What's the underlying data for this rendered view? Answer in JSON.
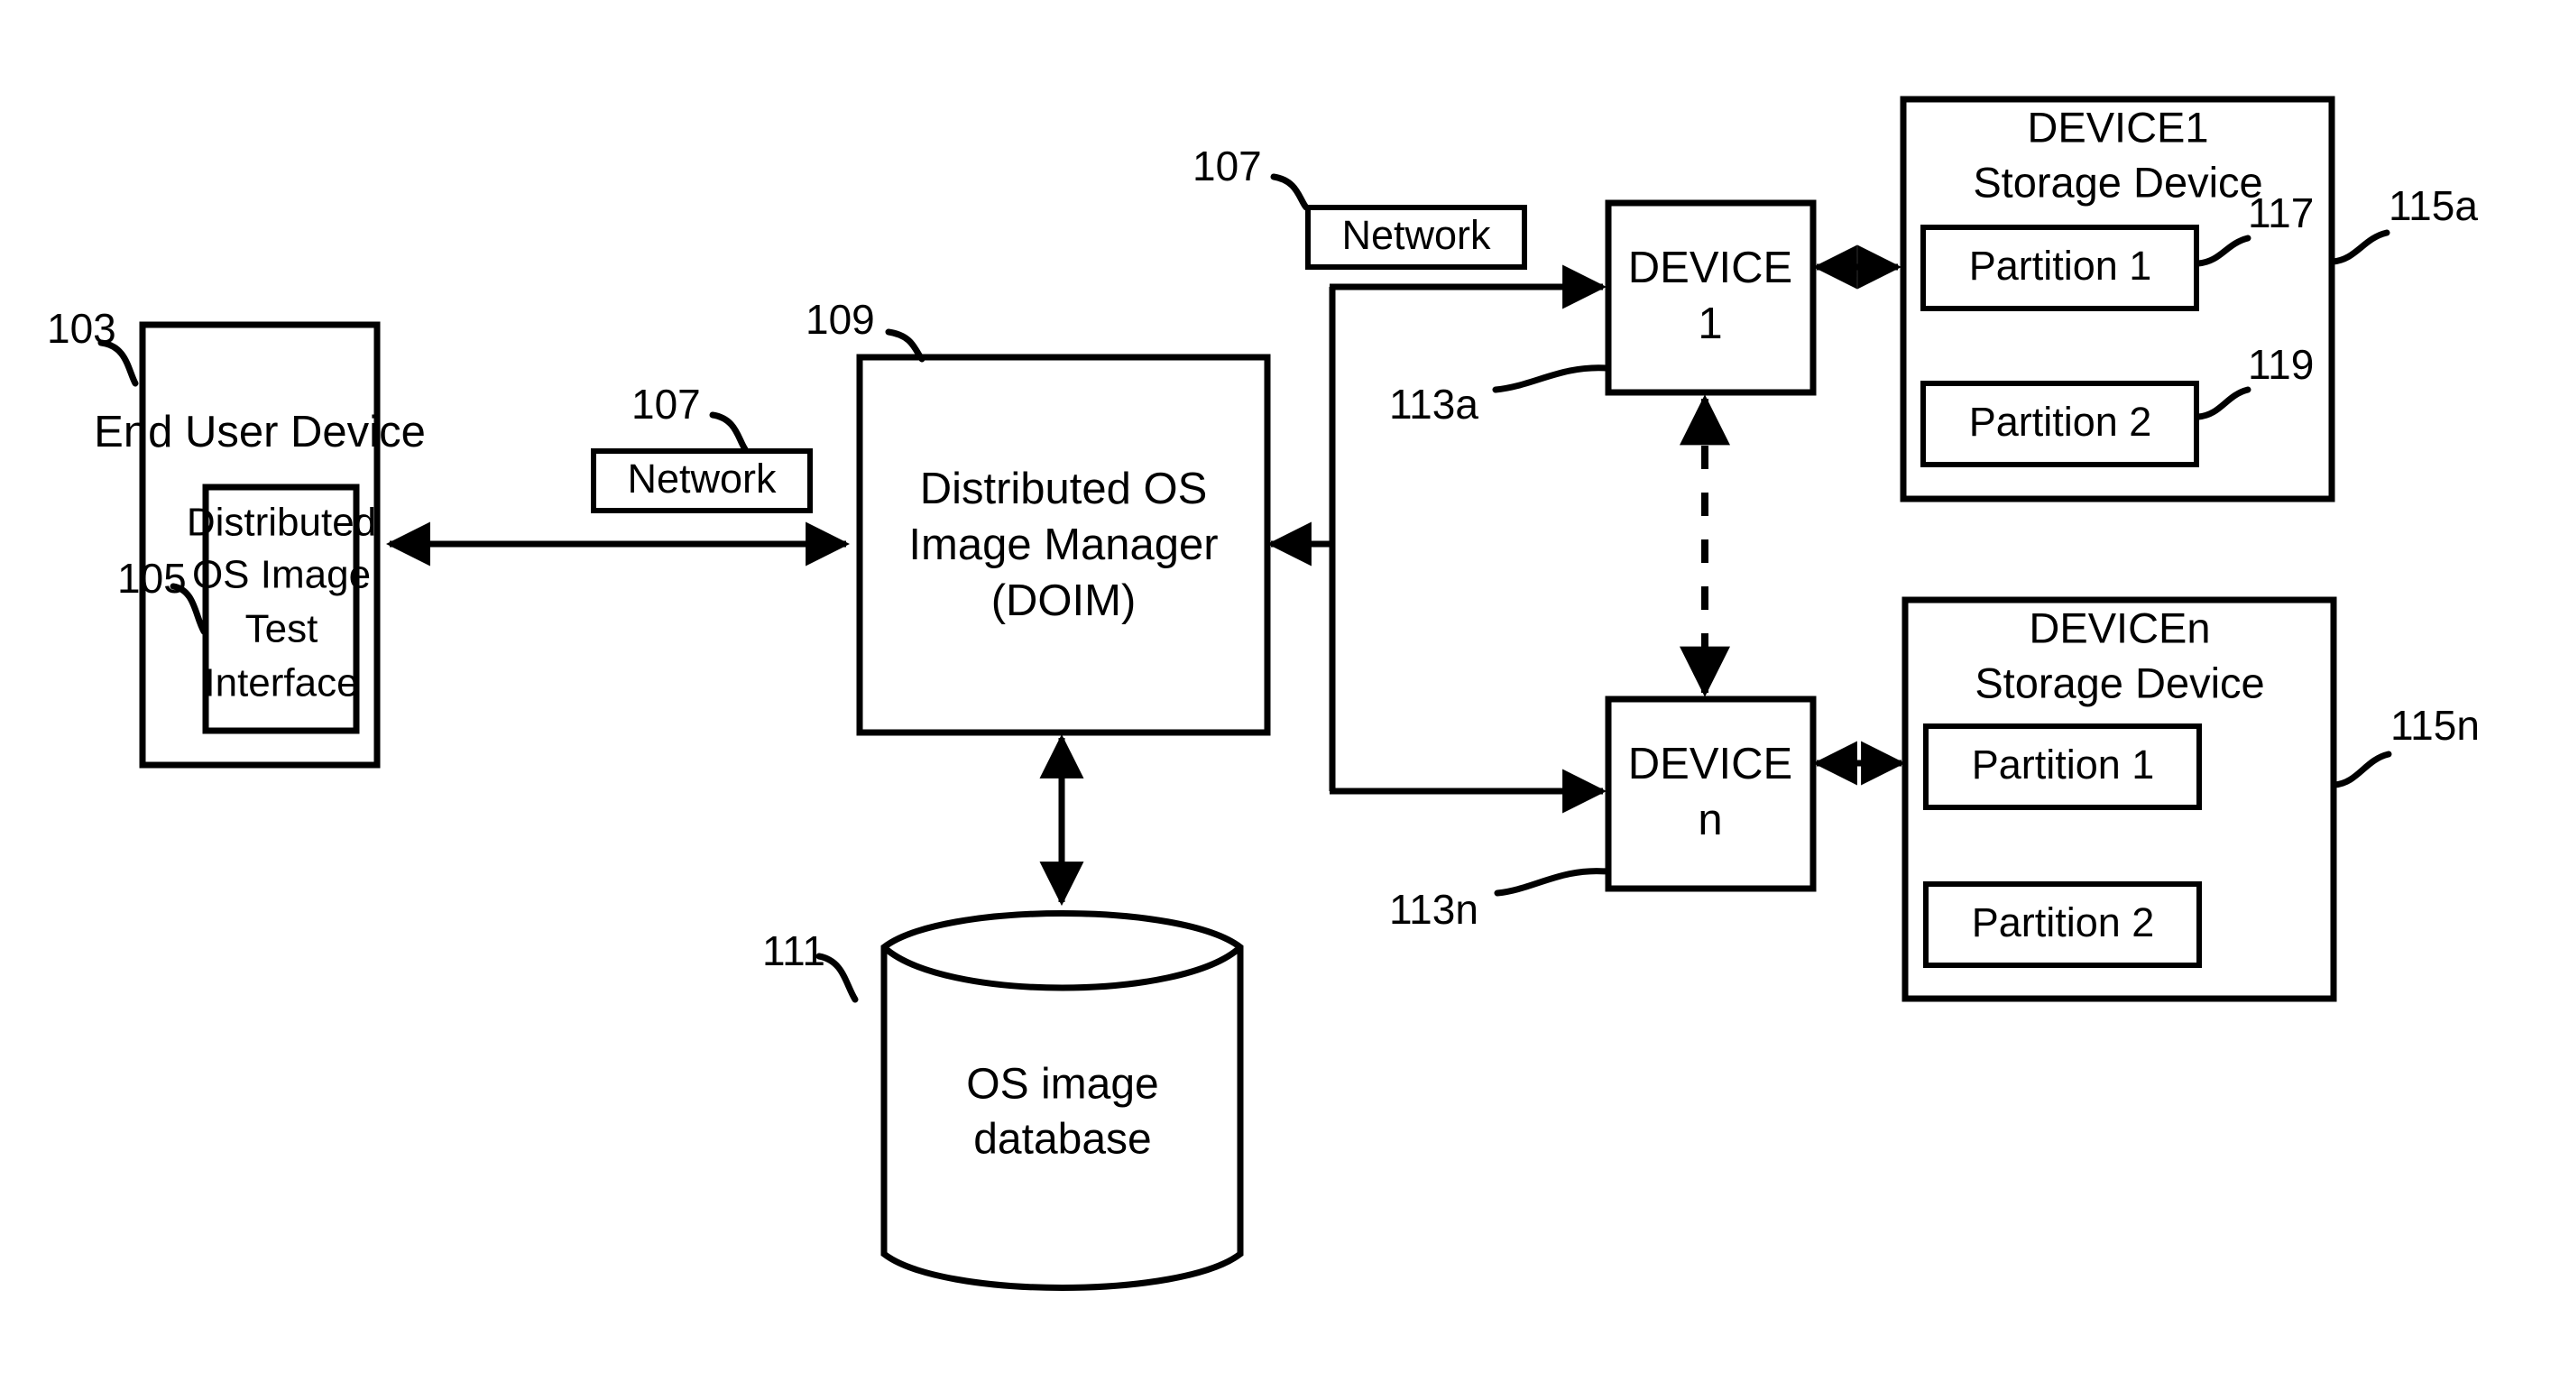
{
  "figure": {
    "title": "Distributed OS Image Manager system block diagram",
    "line_color": "#000000",
    "background_color": "#ffffff"
  },
  "nodes": {
    "end_user_device": {
      "label": "End User Device",
      "ref": "103"
    },
    "test_interface": {
      "line1": "Distributed",
      "line2": "OS Image",
      "line3": "Test",
      "line4": "Interface",
      "ref": "105"
    },
    "network_left": {
      "label": "Network",
      "ref": "107"
    },
    "network_right": {
      "label": "Network",
      "ref": "107"
    },
    "doim": {
      "line1": "Distributed OS",
      "line2": "Image Manager",
      "line3": "(DOIM)",
      "ref": "109"
    },
    "os_image_database": {
      "line1": "OS image",
      "line2": "database",
      "ref": "111"
    },
    "device1": {
      "line1": "DEVICE",
      "line2": "1",
      "ref": "113a"
    },
    "device_n": {
      "line1": "DEVICE",
      "line2": "n",
      "ref": "113n"
    },
    "device1_storage": {
      "line1": "DEVICE1",
      "line2": "Storage Device",
      "ref": "115a",
      "partitions": [
        {
          "label": "Partition 1",
          "ref": "117"
        },
        {
          "label": "Partition 2",
          "ref": "119"
        }
      ]
    },
    "device_n_storage": {
      "line1": "DEVICEn",
      "line2": "Storage Device",
      "ref": "115n",
      "partitions": [
        {
          "label": "Partition 1",
          "ref": ""
        },
        {
          "label": "Partition 2",
          "ref": ""
        }
      ]
    }
  }
}
